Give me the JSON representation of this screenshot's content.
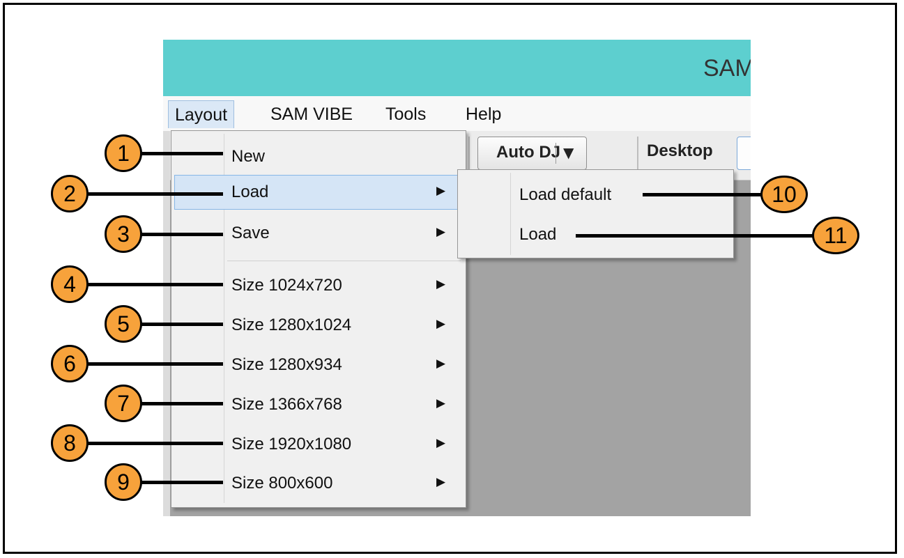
{
  "app": {
    "title": "SAM",
    "menubar": [
      "Layout",
      "SAM VIBE",
      "Tools",
      "Help"
    ],
    "toolbar": {
      "autodj_label": "Auto DJ",
      "desktop_label": "Desktop"
    }
  },
  "layout_menu": {
    "items": [
      {
        "label": "New",
        "has_submenu": false
      },
      {
        "label": "Load",
        "has_submenu": true,
        "highlighted": true
      },
      {
        "label": "Save",
        "has_submenu": true
      },
      {
        "label": "Size 1024x720",
        "has_submenu": true
      },
      {
        "label": "Size 1280x1024",
        "has_submenu": true
      },
      {
        "label": "Size 1280x934",
        "has_submenu": true
      },
      {
        "label": "Size 1366x768",
        "has_submenu": true
      },
      {
        "label": "Size 1920x1080",
        "has_submenu": true
      },
      {
        "label": "Size 800x600",
        "has_submenu": true
      }
    ]
  },
  "load_submenu": {
    "items": [
      "Load default",
      "Load"
    ]
  },
  "callouts": [
    "1",
    "2",
    "3",
    "4",
    "5",
    "6",
    "7",
    "8",
    "9",
    "10",
    "11"
  ],
  "colors": {
    "titlebar": "#5dcfcf",
    "callout_fill": "#f7a23b",
    "highlight": "#d5e5f6",
    "workspace": "#a3a3a3"
  }
}
